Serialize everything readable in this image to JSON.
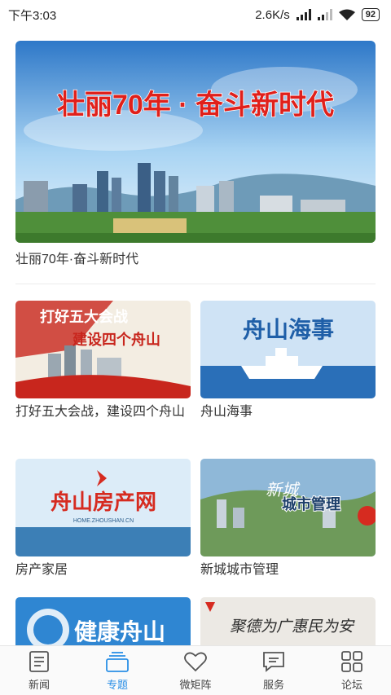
{
  "status": {
    "time": "下午3:03",
    "speed": "2.6K/s",
    "battery": "92"
  },
  "hero": {
    "image_text": "壮丽70年 · 奋斗新时代",
    "title": "壮丽70年·奋斗新时代"
  },
  "cards": [
    {
      "image_text_1": "打好五大会战",
      "image_text_2": "建设四个舟山",
      "title": "打好五大会战，建设四个舟山"
    },
    {
      "image_text": "舟山海事",
      "title": "舟山海事"
    },
    {
      "image_text": "舟山房产网",
      "image_sub": "HOME.ZHOUSHAN.CN",
      "title": "房产家居"
    },
    {
      "image_text_1": "新城",
      "image_text_2": "城市管理",
      "title": "新城城市管理"
    },
    {
      "image_text": "健康舟山"
    },
    {
      "image_text": "聚德为广惠民为安"
    }
  ],
  "tabs": [
    {
      "label": "新闻",
      "icon": "news-icon"
    },
    {
      "label": "专题",
      "icon": "topics-icon"
    },
    {
      "label": "微矩阵",
      "icon": "heart-icon"
    },
    {
      "label": "服务",
      "icon": "chat-icon"
    },
    {
      "label": "论坛",
      "icon": "grid-icon"
    }
  ],
  "colors": {
    "accent": "#2a8fe6",
    "hero_title_red": "#e0201b"
  }
}
